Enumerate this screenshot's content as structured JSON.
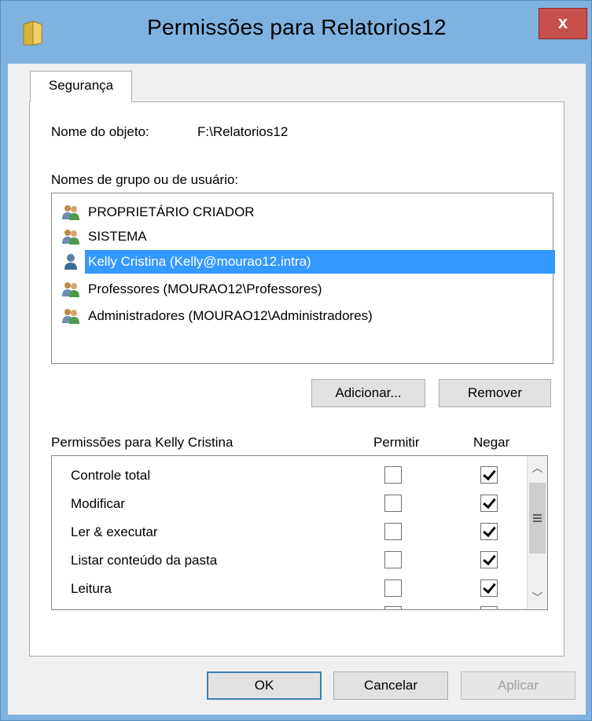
{
  "window": {
    "title": "Permissões para Relatorios12",
    "close_label": "x"
  },
  "tabs": [
    {
      "label": "Segurança",
      "selected": true
    }
  ],
  "object": {
    "name_label": "Nome do objeto:",
    "name_value": "F:\\Relatorios12"
  },
  "users": {
    "label": "Nomes de grupo ou de usuário:",
    "items": [
      {
        "name": "PROPRIETÁRIO CRIADOR",
        "icon": "group-users-icon",
        "selected": false
      },
      {
        "name": "SISTEMA",
        "icon": "group-users-icon",
        "selected": false
      },
      {
        "name": "Kelly Cristina (Kelly@mourao12.intra)",
        "icon": "user-icon",
        "selected": true
      },
      {
        "name": "Professores (MOURAO12\\Professores)",
        "icon": "group-users-icon",
        "selected": false
      },
      {
        "name": "Administradores (MOURAO12\\Administradores)",
        "icon": "group-users-icon",
        "selected": false
      }
    ],
    "add_button": "Adicionar...",
    "remove_button": "Remover"
  },
  "permissions": {
    "label": "Permissões para Kelly Cristina",
    "allow_header": "Permitir",
    "deny_header": "Negar",
    "rows": [
      {
        "name": "Controle total",
        "allow": false,
        "deny": true
      },
      {
        "name": "Modificar",
        "allow": false,
        "deny": true
      },
      {
        "name": "Ler & executar",
        "allow": false,
        "deny": true
      },
      {
        "name": "Listar conteúdo da pasta",
        "allow": false,
        "deny": true
      },
      {
        "name": "Leitura",
        "allow": false,
        "deny": true
      }
    ]
  },
  "footer": {
    "ok": "OK",
    "cancel": "Cancelar",
    "apply": "Aplicar"
  },
  "colors": {
    "selection": "#3399ff",
    "title_bar": "#7fb2df",
    "close_button": "#c7504c"
  }
}
